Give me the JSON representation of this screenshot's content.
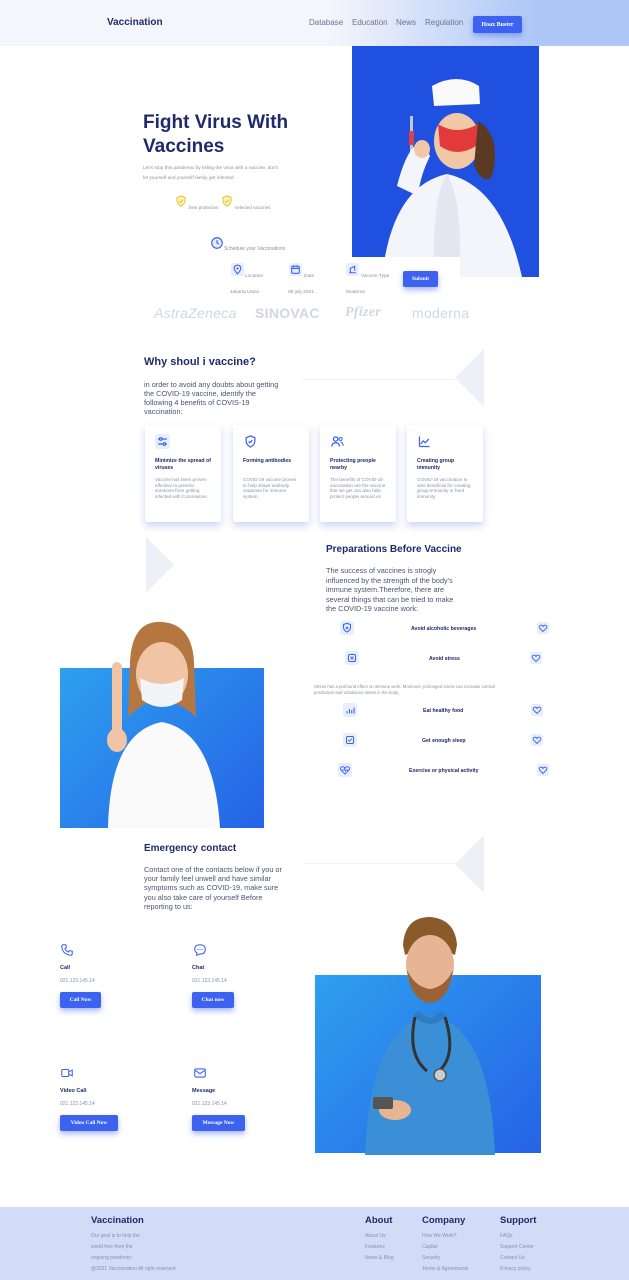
{
  "nav": {
    "brand": "Vaccination",
    "links": [
      "Database",
      "Education",
      "News",
      "Regulation"
    ],
    "cta": "Hoax Buster"
  },
  "hero": {
    "title_line1": "Fight Virus With",
    "title_line2": "Vaccines",
    "subtitle_line1": "Let's stop this pandemic by killing the virus with a vaccine, don't",
    "subtitle_line2": "let yourself and yourself family get infected",
    "badges": [
      "best protection",
      "selected vaccines"
    ],
    "schedule_label": "Schedule your Vaccinations",
    "form": {
      "location_label": "Location",
      "location_value": "Jakarta Utara",
      "date_label": "Date",
      "date_value": "08 july 2021",
      "type_label": "Vaccine Type",
      "type_value": "Moderna",
      "submit": "Submit"
    },
    "brand_logos": [
      "AstraZeneca",
      "SINOVAC",
      "Pfizer",
      "moderna"
    ]
  },
  "why": {
    "title": "Why shoul i vaccine?",
    "desc_lines": [
      "in order to avoid any doubts about getting",
      "the COVID-19 vaccine, identify the",
      "following 4 benefits of COVIS-19",
      "vaccination:"
    ],
    "cards": [
      {
        "title": "Minimize the spread of viruses",
        "desc": "Vaccine has been proven effective to prevent someone from getting infected with Coronavirus.",
        "icon": "sliders-icon"
      },
      {
        "title": "Forming antibodies",
        "desc": "COVID-19 vaccine proven to help shape antibody response for immune system.",
        "icon": "shield-check-icon"
      },
      {
        "title": "Protecting preople nearby",
        "desc": "The benefits of COVID-19 vaccination are the vaccine that we get can also help protect people around us",
        "icon": "users-icon"
      },
      {
        "title": "Creating group immunity",
        "desc": "COVID-19 vaccination is also beneficial for creating group immunity or herd immunity",
        "icon": "chart-line-icon"
      }
    ]
  },
  "prep": {
    "title": "Preparations Before Vaccine",
    "desc_lines": [
      "The success of vaccines is strogly",
      "influenced by the strength of the body's",
      "immune system.Therefore, there are",
      "several things that can be tried to make",
      "the COVID-19 vaccine work:"
    ],
    "items": [
      {
        "label": "Avoid alcoholic beverages",
        "icon": "shield-x-icon"
      },
      {
        "label": "Avoid stress",
        "icon": "x-square-icon"
      },
      {
        "label": "Eat healthy food",
        "icon": "bar-chart-icon"
      },
      {
        "label": "Get enough sleep",
        "icon": "check-square-icon"
      },
      {
        "label": "Exercise or physical activity",
        "icon": "heart-pulse-icon"
      }
    ],
    "stress_note_line1": "Stress has a profound effect on immune work. Moreover, prolonged stress can increase cortisol",
    "stress_note_line2": "production and unbalance stress in the body."
  },
  "emergency": {
    "title": "Emergency contact",
    "desc_lines": [
      "Contact one of the contacts below if you or",
      "your family feel unwell and have similar",
      "symptoms such as COVID-19, make sure",
      "you also take care of yourself Before",
      "reporting to us:"
    ],
    "contacts": [
      {
        "label": "Call",
        "value": "021.123.145.14",
        "button": "Call Now",
        "icon": "phone-icon"
      },
      {
        "label": "Chat",
        "value": "021.123.145.14",
        "button": "Chat now",
        "icon": "chat-icon"
      },
      {
        "label": "Video Call",
        "value": "021.123.145.14",
        "button": "Video Call Now",
        "icon": "video-icon"
      },
      {
        "label": "Message",
        "value": "021.123.145.14",
        "button": "Message Now",
        "icon": "mail-icon"
      }
    ]
  },
  "footer": {
    "brand": "Vaccination",
    "tagline": [
      "Our goal is to help the",
      "world free from the",
      "ongoing pandemic"
    ],
    "copyright": "@2021 Vaccionation All right reserved",
    "about": {
      "title": "About",
      "links": [
        "About Us",
        "Features",
        "News & Blog"
      ]
    },
    "company": {
      "title": "Company",
      "links": [
        "How We Work?",
        "Capital",
        "Security",
        "Terms & Agreements"
      ]
    },
    "support": {
      "title": "Support",
      "links": [
        "FAQs",
        "Support Center",
        "Contact Us",
        "Privacy policy"
      ]
    }
  },
  "colors": {
    "primary": "#3d62f0",
    "navy": "#1e2a6b",
    "hero_bg": "#1f50e0",
    "footer_bg": "#d3dcf7"
  }
}
